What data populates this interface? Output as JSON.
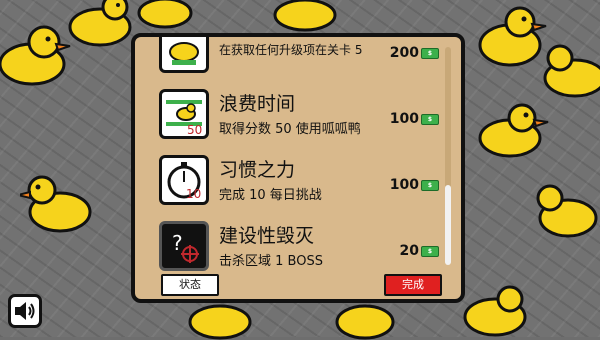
{
  "challenges": [
    {
      "title": "",
      "desc": "在获取任何升级项在关卡 5",
      "reward": "200",
      "icon": "upgrade-duck-icon"
    },
    {
      "title": "浪费时间",
      "desc": "取得分数 50 使用呱呱鸭",
      "reward": "100",
      "icon": "duck-score-icon",
      "badge": "50"
    },
    {
      "title": "习惯之力",
      "desc": "完成 10 每日挑战",
      "reward": "100",
      "icon": "stopwatch-icon",
      "badge": "10"
    },
    {
      "title": "建设性毁灭",
      "desc": "击杀区域 1 BOSS",
      "reward": "20",
      "icon": "crosshair-unknown-icon",
      "badge": "?"
    }
  ],
  "buttons": {
    "status": "状态",
    "done": "完成"
  },
  "cash_label": "$",
  "watermark": "",
  "colors": {
    "panel": "#d9b98c",
    "done": "#e02020",
    "cash": "#3db04b",
    "duck": "#f6d31c"
  }
}
